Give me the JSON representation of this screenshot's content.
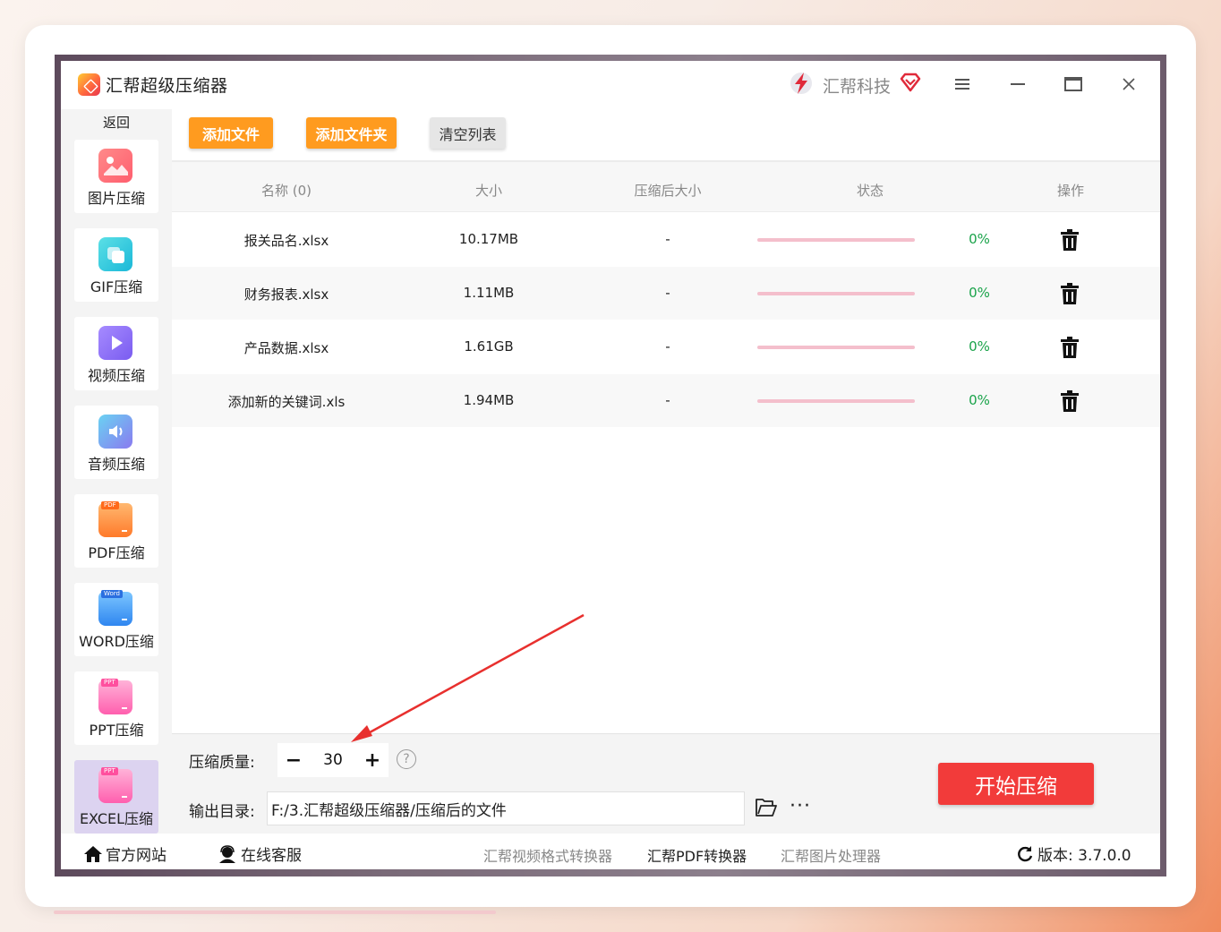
{
  "app": {
    "title": "汇帮超级压缩器",
    "brand": "汇帮科技"
  },
  "sidebar": {
    "back": "返回",
    "items": [
      {
        "label": "图片压缩",
        "icon": "image-icon"
      },
      {
        "label": "GIF压缩",
        "icon": "gif-icon"
      },
      {
        "label": "视频压缩",
        "icon": "video-icon"
      },
      {
        "label": "音频压缩",
        "icon": "audio-icon"
      },
      {
        "label": "PDF压缩",
        "icon": "pdf-icon",
        "tag": "PDF"
      },
      {
        "label": "WORD压缩",
        "icon": "word-icon",
        "tag": "Word"
      },
      {
        "label": "PPT压缩",
        "icon": "ppt-icon",
        "tag": "PPT"
      },
      {
        "label": "EXCEL压缩",
        "icon": "excel-icon",
        "tag": "PPT"
      }
    ]
  },
  "toolbar": {
    "add_file": "添加文件",
    "add_folder": "添加文件夹",
    "clear": "清空列表"
  },
  "table": {
    "headers": {
      "name": "名称 (0)",
      "size": "大小",
      "compressed": "压缩后大小",
      "status": "状态",
      "action": "操作"
    },
    "rows": [
      {
        "name": "报关品名.xlsx",
        "size": "10.17MB",
        "compressed": "-",
        "percent": "0%",
        "progress": 0
      },
      {
        "name": "财务报表.xlsx",
        "size": "1.11MB",
        "compressed": "-",
        "percent": "0%",
        "progress": 0
      },
      {
        "name": "产品数据.xlsx",
        "size": "1.61GB",
        "compressed": "-",
        "percent": "0%",
        "progress": 0
      },
      {
        "name": "添加新的关键词.xls",
        "size": "1.94MB",
        "compressed": "-",
        "percent": "0%",
        "progress": 0
      }
    ]
  },
  "settings": {
    "quality_label": "压缩质量:",
    "quality_value": "30",
    "help": "?",
    "output_label": "输出目录:",
    "output_path": "F:/3.汇帮超级压缩器/压缩后的文件",
    "more": "···",
    "start": "开始压缩"
  },
  "footer": {
    "website": "官方网站",
    "service": "在线客服",
    "links": [
      "汇帮视频格式转换器",
      "汇帮PDF转换器",
      "汇帮图片处理器"
    ],
    "version": "版本: 3.7.0.0"
  },
  "colors": {
    "accent_orange": "#ff9b1f",
    "start_red": "#f23b3a",
    "progress_pink": "#f4bfcc",
    "percent_green": "#1aa34a"
  }
}
